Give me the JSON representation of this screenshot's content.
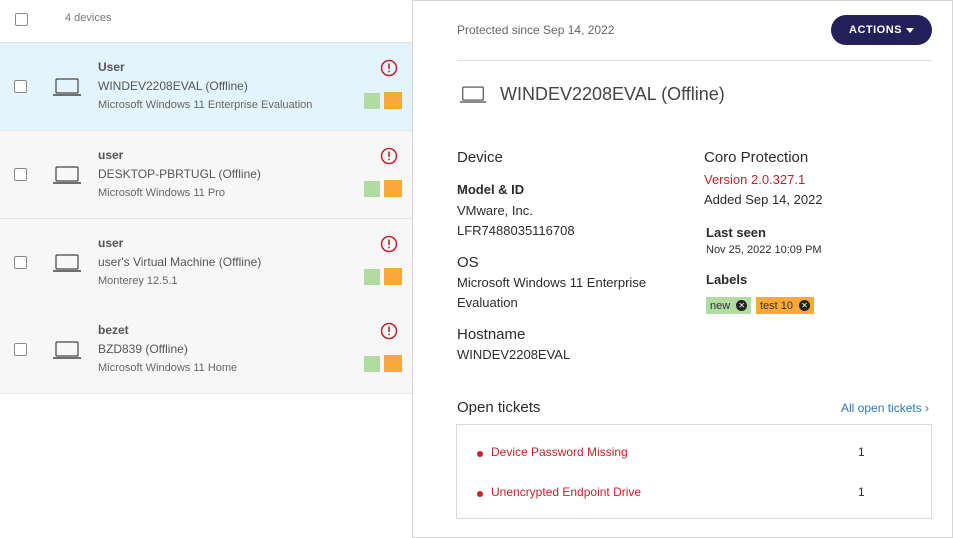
{
  "list": {
    "device_count": "4 devices",
    "rows": [
      {
        "user": "User",
        "name": "WINDEV2208EVAL (Offline)",
        "os": "Microsoft Windows 11 Enterprise Evaluation"
      },
      {
        "user": "user",
        "name": "DESKTOP-PBRTUGL (Offline)",
        "os": "Microsoft Windows 11 Pro"
      },
      {
        "user": "user",
        "name": "user's Virtual Machine (Offline)",
        "os": "Monterey 12.5.1"
      },
      {
        "user": "bezet",
        "name": "BZD839 (Offline)",
        "os": "Microsoft Windows 11 Home"
      }
    ]
  },
  "detail": {
    "protected_since": "Protected since Sep 14, 2022",
    "actions_label": "ACTIONS",
    "title": "WINDEV2208EVAL (Offline)",
    "device_heading": "Device",
    "model_label": "Model & ID",
    "model_vendor": "VMware, Inc.",
    "model_id": "LFR7488035116708",
    "os_label": "OS",
    "os_line1": "Microsoft Windows 11 Enterprise",
    "os_line2": "Evaluation",
    "hostname_label": "Hostname",
    "hostname": "WINDEV2208EVAL",
    "coro_heading": "Coro Protection",
    "version": "Version 2.0.327.1",
    "added": "Added Sep 14, 2022",
    "last_seen_label": "Last seen",
    "last_seen": "Nov 25, 2022 10:09 PM",
    "labels_label": "Labels",
    "labels": [
      {
        "text": "new",
        "color": "#b0dba1"
      },
      {
        "text": "test 10",
        "color": "#f8a93a"
      }
    ],
    "open_tickets_heading": "Open tickets",
    "all_tickets_link": "All open tickets ›",
    "tickets": [
      {
        "name": "Device Password Missing",
        "count": "1"
      },
      {
        "name": "Unencrypted Endpoint Drive",
        "count": "1"
      }
    ]
  },
  "colors": {
    "selected_row": "#e3f4fc",
    "actions_button": "#22215a",
    "alert_red": "#c0232c",
    "label_green": "#b0dba1",
    "label_orange": "#f8a93a"
  },
  "icons": {
    "device": "laptop-icon",
    "alert": "alert-circle-icon",
    "label_remove": "close-circle-icon"
  }
}
